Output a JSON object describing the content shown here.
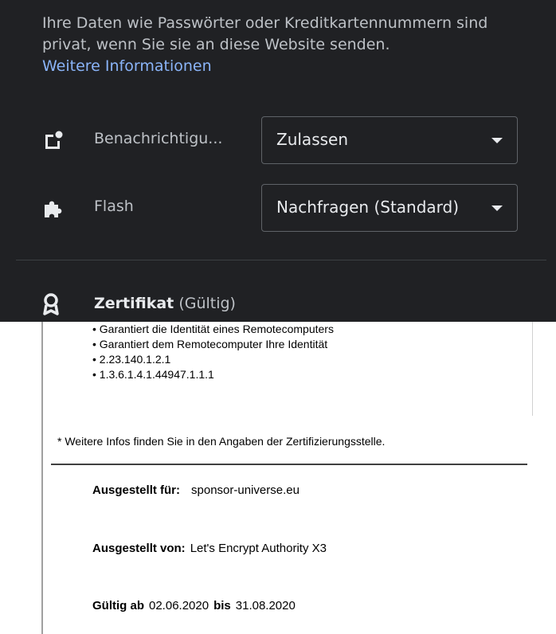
{
  "info": {
    "text": "Ihre Daten wie Passwörter oder Kreditkartennummern sind privat, wenn Sie sie an diese Website senden.",
    "link": "Weitere Informationen"
  },
  "permissions": [
    {
      "label": "Benachrichtigu...",
      "value": "Zulassen",
      "icon": "notification-icon"
    },
    {
      "label": "Flash",
      "value": "Nachfragen (Standard)",
      "icon": "puzzle-icon"
    }
  ],
  "certificate": {
    "title": "Zertifikat",
    "status": "(Gültig)",
    "purposes": [
      "• Garantiert die Identität eines Remotecomputers",
      "• Garantiert dem Remotecomputer Ihre Identität",
      "• 2.23.140.1.2.1",
      "• 1.3.6.1.4.1.44947.1.1.1"
    ],
    "note": "* Weitere Infos finden Sie in den Angaben der Zertifizierungsstelle.",
    "issued_to_label": "Ausgestellt für:",
    "issued_to": "sponsor-universe.eu",
    "issued_by_label": "Ausgestellt von:",
    "issued_by": "Let's Encrypt Authority X3",
    "valid_from_label": "Gültig ab",
    "valid_from": "02.06.2020",
    "valid_to_label": "bis",
    "valid_to": "31.08.2020"
  },
  "colors": {
    "panel_bg": "#202124",
    "link": "#8ab4f8",
    "text": "#e8eaed"
  }
}
